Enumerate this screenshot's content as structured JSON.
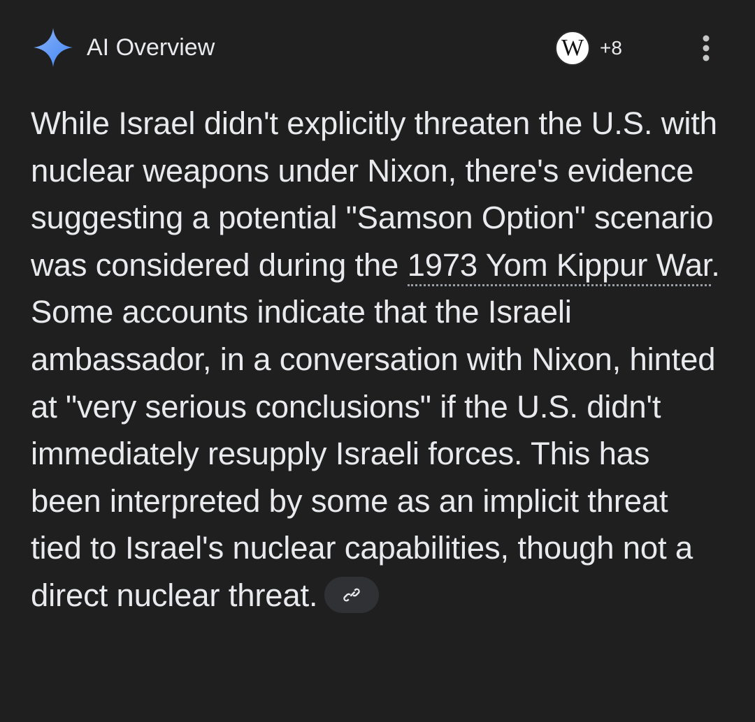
{
  "header": {
    "title": "AI Overview",
    "icon": "ai-sparkle-icon",
    "sources": {
      "icon": "wikipedia-icon",
      "icon_letter": "W",
      "extra_count": "+8"
    },
    "menu_icon": "more-vert-icon"
  },
  "overview": {
    "text_before": "While Israel didn't explicitly threaten the U.S. with nuclear weapons under Nixon, there's evidence suggesting a potential \"Samson Option\" scenario was considered during the ",
    "link_text": "1973 Yom Kippur War",
    "text_after": ". Some accounts indicate that the Israeli ambassador, in a conversation with Nixon, hinted at \"very serious conclusions\" if the U.S. didn't immediately resupply Israeli forces. This has been interpreted by some as an implicit threat tied to Israel's nuclear capabilities, though not a direct nuclear threat.",
    "chip_icon": "link-icon"
  },
  "colors": {
    "background": "#1f1f1f",
    "text": "#e8eaed",
    "sparkle": "#5b9cf6",
    "chip": "#303134"
  }
}
